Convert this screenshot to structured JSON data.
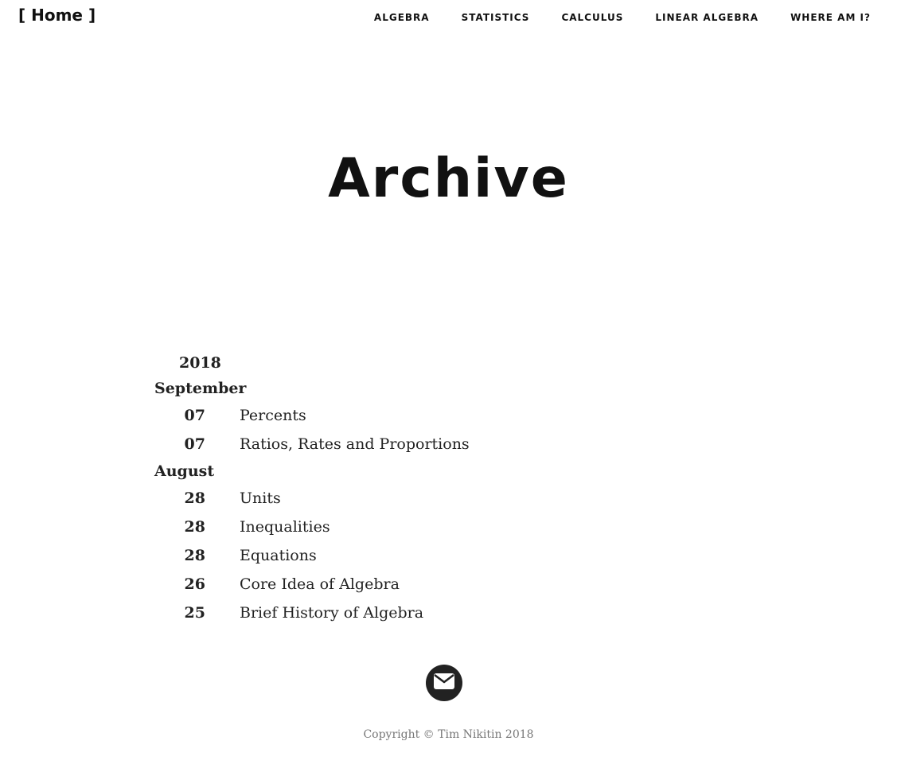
{
  "nav": {
    "brand": "[ Home ]",
    "links": [
      "ALGEBRA",
      "STATISTICS",
      "CALCULUS",
      "LINEAR ALGEBRA",
      "WHERE AM I?"
    ]
  },
  "page_title": "Archive",
  "archive": {
    "year": "2018",
    "months": [
      {
        "name": "September",
        "posts": [
          {
            "day": "07",
            "title": "Percents"
          },
          {
            "day": "07",
            "title": "Ratios, Rates and Proportions"
          }
        ]
      },
      {
        "name": "August",
        "posts": [
          {
            "day": "28",
            "title": "Units"
          },
          {
            "day": "28",
            "title": "Inequalities"
          },
          {
            "day": "28",
            "title": "Equations"
          },
          {
            "day": "26",
            "title": "Core Idea of Algebra"
          },
          {
            "day": "25",
            "title": "Brief History of Algebra"
          }
        ]
      }
    ]
  },
  "footer": {
    "mail_icon": "envelope-icon",
    "copyright": "Copyright © Tim Nikitin 2018"
  },
  "colors": {
    "text": "#222222",
    "footer_text": "#777777",
    "icon_circle": "#222222"
  }
}
